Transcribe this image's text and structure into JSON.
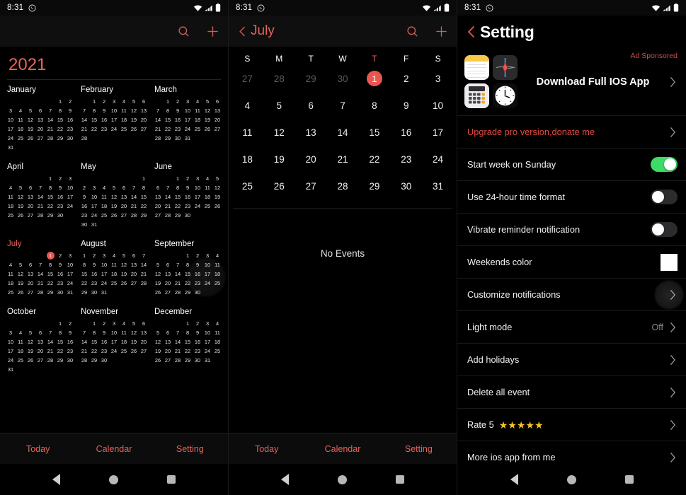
{
  "status_bar": {
    "time": "8:31",
    "whatsapp_icon": "whatsapp-icon",
    "wifi_icon": "wifi-icon",
    "signal_icon": "cellular-signal-icon",
    "battery_icon": "battery-icon"
  },
  "colors": {
    "accent_red": "#e8635b",
    "today_circle": "#e8574f",
    "toggle_on": "#3ddc67",
    "toggle_off": "#2c2c2e",
    "star_gold": "#f6c324",
    "ad_label": "#c4524a",
    "upgrade_red": "#e24b42"
  },
  "panel_year": {
    "header": {
      "search_icon": "search-icon",
      "add_icon": "plus-icon"
    },
    "year_title": "2021",
    "current_month": "July",
    "today": 1,
    "weekday_start": "Sunday",
    "months": [
      {
        "name": "January",
        "lead_blank": 5,
        "days": 31
      },
      {
        "name": "February",
        "lead_blank": 1,
        "days": 28
      },
      {
        "name": "March",
        "lead_blank": 1,
        "days": 31
      },
      {
        "name": "April",
        "lead_blank": 4,
        "days": 30
      },
      {
        "name": "May",
        "lead_blank": 6,
        "days": 31
      },
      {
        "name": "June",
        "lead_blank": 2,
        "days": 30
      },
      {
        "name": "July",
        "lead_blank": 4,
        "days": 31
      },
      {
        "name": "August",
        "lead_blank": 0,
        "days": 31
      },
      {
        "name": "September",
        "lead_blank": 3,
        "days": 30
      },
      {
        "name": "October",
        "lead_blank": 5,
        "days": 31
      },
      {
        "name": "November",
        "lead_blank": 1,
        "days": 30
      },
      {
        "name": "December",
        "lead_blank": 3,
        "days": 31
      }
    ],
    "tabs": [
      "Today",
      "Calendar",
      "Setting"
    ]
  },
  "panel_month": {
    "header": {
      "back_icon": "back-chevron-icon",
      "title": "July",
      "search_icon": "search-icon",
      "add_icon": "plus-icon"
    },
    "weekdays": [
      "S",
      "M",
      "T",
      "W",
      "T",
      "F",
      "S"
    ],
    "today_weekday_index": 4,
    "leading_days": [
      27,
      28,
      29,
      30
    ],
    "days": 31,
    "today": 1,
    "events_empty_text": "No Events",
    "tabs": [
      "Today",
      "Calendar",
      "Setting"
    ]
  },
  "panel_setting": {
    "header": {
      "back_icon": "back-chevron-icon",
      "title": "Setting"
    },
    "ad": {
      "label": "Ad Sponsored",
      "text": "Download Full IOS App",
      "chevron_icon": "chevron-right-icon",
      "icons": [
        "notes-app-icon",
        "voice-memos-app-icon",
        "calculator-app-icon",
        "clock-app-icon"
      ]
    },
    "rows": [
      {
        "label": "Upgrade pro version,donate me",
        "type": "chevron",
        "accent": true
      },
      {
        "label": "Start week on Sunday",
        "type": "toggle",
        "value": "on"
      },
      {
        "label": "Use 24-hour time format",
        "type": "toggle",
        "value": "off"
      },
      {
        "label": "Vibrate reminder notification",
        "type": "toggle",
        "value": "off"
      },
      {
        "label": "Weekends color",
        "type": "swatch",
        "value": "#ffffff"
      },
      {
        "label": "Customize notifications",
        "type": "chevron",
        "pressed": true
      },
      {
        "label": "Light mode",
        "type": "chevron",
        "value": "Off"
      },
      {
        "label": "Add holidays",
        "type": "chevron"
      },
      {
        "label": "Delete all event",
        "type": "chevron"
      },
      {
        "label": "Rate 5",
        "type": "chevron",
        "stars": 5
      },
      {
        "label": "More ios app from me",
        "type": "chevron"
      }
    ]
  },
  "nav_bar": {
    "back_icon": "nav-back-icon",
    "home_icon": "nav-home-icon",
    "recents_icon": "nav-recents-icon"
  }
}
